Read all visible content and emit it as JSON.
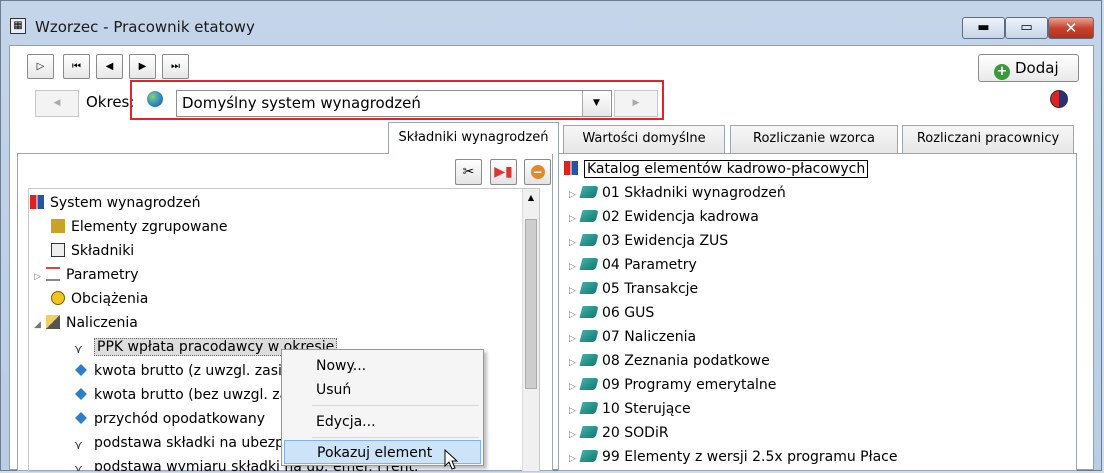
{
  "window": {
    "title": "Wzorzec - Pracownik etatowy",
    "min": "▬",
    "max": "▭",
    "close": "✕"
  },
  "toolbar": {
    "nav": [
      "▷",
      "⏮",
      "◀",
      "▶",
      "⏭"
    ],
    "add_label": "Dodaj"
  },
  "period": {
    "label": "Okres:",
    "value": "Domyślny system wynagrodzeń",
    "prev": "◀",
    "next": "▶",
    "dropdown": "▼"
  },
  "tabs": [
    "Składniki wynagrodzeń",
    "Wartości domyślne",
    "Rozliczanie wzorca",
    "Rozliczani pracownicy"
  ],
  "left_tree": [
    {
      "label": "System wynagrodzeń",
      "icon": "system-icon"
    },
    {
      "label": "Elementy zgrupowane",
      "icon": "group-icon"
    },
    {
      "label": "Składniki",
      "icon": "components-icon"
    },
    {
      "label": "Parametry",
      "icon": "params-icon"
    },
    {
      "label": "Obciążenia",
      "icon": "charges-icon"
    },
    {
      "label": "Naliczenia",
      "icon": "accruals-icon"
    },
    {
      "label": "PPK wpłata pracodawcy w okresie",
      "icon": "formula-icon"
    },
    {
      "label": "kwota brutto (z uwzgl. zasił",
      "icon": "diamond-icon"
    },
    {
      "label": "kwota brutto (bez uwzgl. za",
      "icon": "diamond-icon"
    },
    {
      "label": "przychód opodatkowany",
      "icon": "diamond-icon"
    },
    {
      "label": "podstawa składki na ubezpi",
      "icon": "formula-icon"
    },
    {
      "label": "podstawa wymiaru składki na ub. emer. i rent.",
      "icon": "formula-icon"
    }
  ],
  "context_menu": [
    "Nowy...",
    "Usuń",
    "Edycja...",
    "Pokazuj element"
  ],
  "catalog": {
    "root": "Katalog elementów kadrowo-płacowych",
    "items": [
      "01 Składniki wynagrodzeń",
      "02 Ewidencja kadrowa",
      "03 Ewidencja ZUS",
      "04 Parametry",
      "05 Transakcje",
      "06 GUS",
      "07 Naliczenia",
      "08 Zeznania podatkowe",
      "09 Programy emerytalne",
      "10 Sterujące",
      "20 SODiR",
      "99 Elementy z wersji 2.5x programu Płace"
    ]
  },
  "colors": {
    "highlight": "#e0242a",
    "selection": "#cde3f7",
    "book": "#1e9a8f"
  }
}
